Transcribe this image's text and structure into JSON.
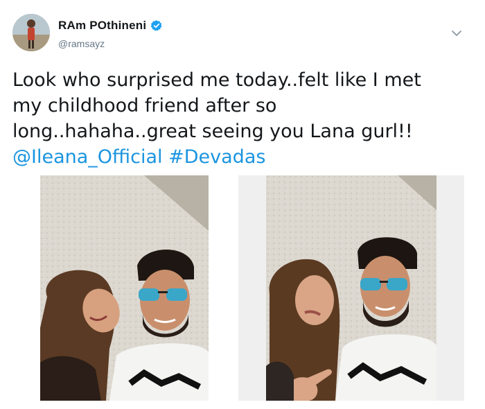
{
  "tweet": {
    "author": {
      "display_name": "RAm POthineni",
      "handle": "@ramsayz",
      "verified": true
    },
    "text_lines": [
      "Look who surprised me today..felt like I met",
      "my childhood friend after so",
      "long..hahaha..great seeing you Lana gurl!!"
    ],
    "mention": "@Ileana_Official",
    "hashtag": "#Devadas",
    "icons": {
      "avatar": "profile-photo",
      "verified": "verified-badge-icon",
      "menu": "chevron-down-icon"
    },
    "colors": {
      "link": "#1b95e0",
      "verified": "#1da1f2",
      "text": "#14171a",
      "secondary": "#657786"
    },
    "media": [
      {
        "name": "selfie-photo-1"
      },
      {
        "name": "selfie-photo-2"
      }
    ]
  }
}
